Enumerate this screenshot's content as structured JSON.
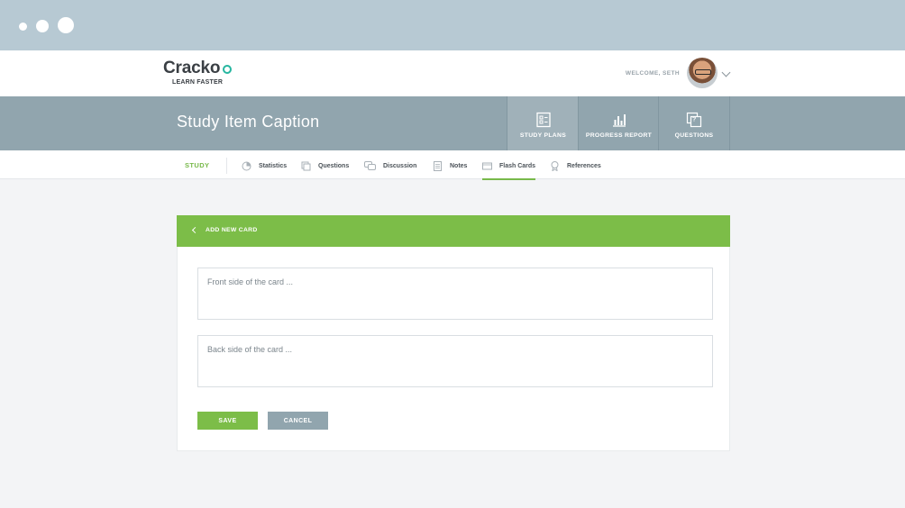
{
  "brand": {
    "name": "Cracko",
    "tagline": "LEARN FASTER",
    "accent": "#27b6a0"
  },
  "user": {
    "welcome": "WELCOME, SETH"
  },
  "hero": {
    "title": "Study Item Caption",
    "tabs": [
      {
        "label": "STUDY PLANS",
        "icon": "study-plans-icon",
        "active": true
      },
      {
        "label": "PROGRESS REPORT",
        "icon": "bar-chart-icon",
        "active": false
      },
      {
        "label": "QUESTIONS",
        "icon": "questions-icon",
        "active": false
      }
    ]
  },
  "subnav": {
    "section": "STUDY",
    "items": [
      {
        "label": "Statistics",
        "icon": "statistics-icon"
      },
      {
        "label": "Questions",
        "icon": "questions-icon"
      },
      {
        "label": "Discussion",
        "icon": "discussion-icon"
      },
      {
        "label": "Notes",
        "icon": "notes-icon"
      },
      {
        "label": "Flash Cards",
        "icon": "flash-cards-icon",
        "active": true
      },
      {
        "label": "References",
        "icon": "references-icon"
      }
    ]
  },
  "card_form": {
    "title": "ADD NEW CARD",
    "front_placeholder": "Front side of the card ...",
    "back_placeholder": "Back side of the card ...",
    "save_label": "SAVE",
    "cancel_label": "CANCEL"
  },
  "colors": {
    "green": "#7cbd48",
    "slate": "#91a5ae",
    "chrome": "#b7c9d3"
  }
}
